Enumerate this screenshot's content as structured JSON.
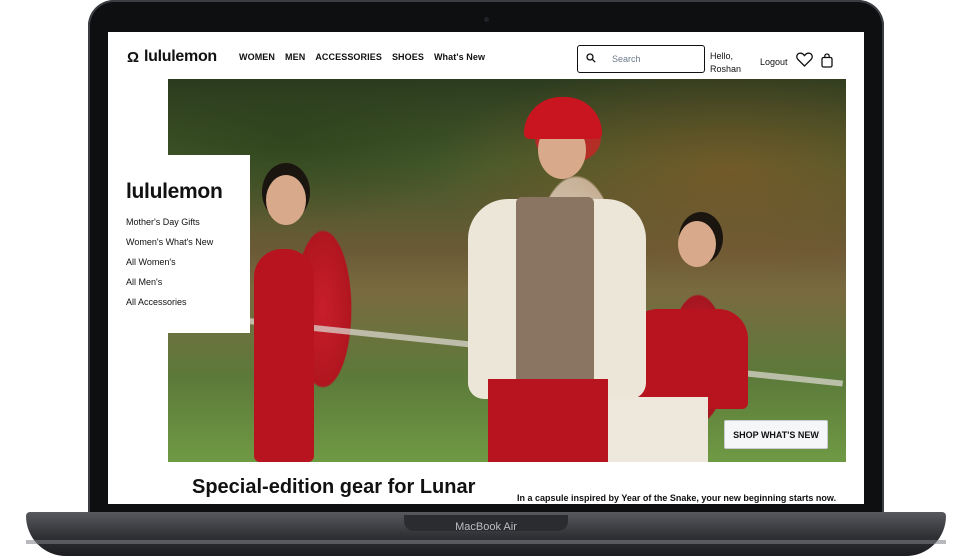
{
  "device": {
    "base_label": "MacBook Air"
  },
  "header": {
    "logo_text": "lululemon",
    "logo_icon": "lululemon-omega-icon",
    "nav": [
      "WOMEN",
      "MEN",
      "ACCESSORIES",
      "SHOES",
      "What's New"
    ],
    "search": {
      "placeholder": "Search",
      "icon": "search-icon"
    },
    "greeting_line1": "Hello,",
    "greeting_line2": "Roshan",
    "logout": "Logout",
    "wishlist_icon": "heart-icon",
    "bag_icon": "shopping-bag-icon"
  },
  "side_menu": {
    "title": "lululemon",
    "links": [
      "Mother's Day Gifts",
      "Women's What's New",
      "All Women's",
      "All Men's",
      "All Accessories"
    ]
  },
  "hero": {
    "cta": "SHOP WHAT'S NEW"
  },
  "promo": {
    "headline": "Special-edition gear for Lunar",
    "subtext": "In a capsule inspired by Year of the Snake, your new beginning starts now."
  },
  "colors": {
    "brand_red": "#c8151f",
    "text": "#111111"
  }
}
